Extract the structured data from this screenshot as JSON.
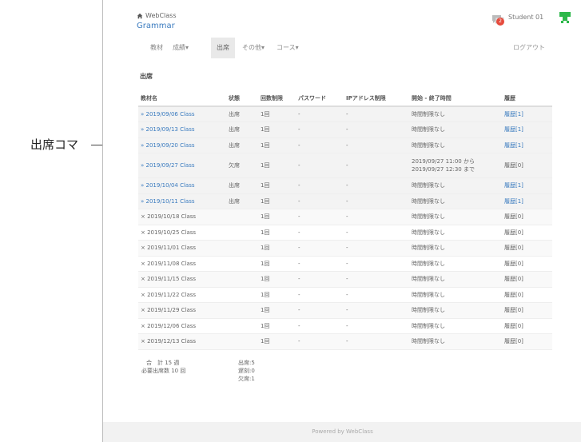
{
  "annotation": {
    "label": "出席コマ"
  },
  "header": {
    "home_label": "WebClass",
    "course_title": "Grammar",
    "notification_count": "2",
    "user_name": "Student 01"
  },
  "nav": {
    "items": [
      {
        "label": "教材"
      },
      {
        "label": "成績▾"
      },
      {
        "label": "出席"
      },
      {
        "label": "その他▾"
      },
      {
        "label": "コース▾"
      }
    ],
    "active_index": 2,
    "logout_label": "ログアウト"
  },
  "section_title": "出席",
  "table": {
    "headers": [
      "教材名",
      "状態",
      "回数制限",
      "パスワード",
      "IPアドレス制限",
      "開始 - 終了時間",
      "履歴"
    ],
    "rows": [
      {
        "name": "» 2019/09/06 Class",
        "status": "出席",
        "limit": "1回",
        "password": "-",
        "ip": "-",
        "period": "時間制限なし",
        "period2": "",
        "history": "履歴[1]"
      },
      {
        "name": "» 2019/09/13 Class",
        "status": "出席",
        "limit": "1回",
        "password": "-",
        "ip": "-",
        "period": "時間制限なし",
        "period2": "",
        "history": "履歴[1]"
      },
      {
        "name": "» 2019/09/20 Class",
        "status": "出席",
        "limit": "1回",
        "password": "-",
        "ip": "-",
        "period": "時間制限なし",
        "period2": "",
        "history": "履歴[1]"
      },
      {
        "name": "» 2019/09/27 Class",
        "status": "欠席",
        "limit": "1回",
        "password": "-",
        "ip": "-",
        "period": "2019/09/27 11:00 から",
        "period2": "2019/09/27 12:30 まで",
        "history": "履歴[0]"
      },
      {
        "name": "» 2019/10/04 Class",
        "status": "出席",
        "limit": "1回",
        "password": "-",
        "ip": "-",
        "period": "時間制限なし",
        "period2": "",
        "history": "履歴[1]"
      },
      {
        "name": "» 2019/10/11 Class",
        "status": "出席",
        "limit": "1回",
        "password": "-",
        "ip": "-",
        "period": "時間制限なし",
        "period2": "",
        "history": "履歴[1]"
      },
      {
        "name": "× 2019/10/18 Class",
        "status": "",
        "limit": "1回",
        "password": "-",
        "ip": "-",
        "period": "時間制限なし",
        "period2": "",
        "history": "履歴[0]"
      },
      {
        "name": "× 2019/10/25 Class",
        "status": "",
        "limit": "1回",
        "password": "-",
        "ip": "-",
        "period": "時間制限なし",
        "period2": "",
        "history": "履歴[0]"
      },
      {
        "name": "× 2019/11/01 Class",
        "status": "",
        "limit": "1回",
        "password": "-",
        "ip": "-",
        "period": "時間制限なし",
        "period2": "",
        "history": "履歴[0]"
      },
      {
        "name": "× 2019/11/08 Class",
        "status": "",
        "limit": "1回",
        "password": "-",
        "ip": "-",
        "period": "時間制限なし",
        "period2": "",
        "history": "履歴[0]"
      },
      {
        "name": "× 2019/11/15 Class",
        "status": "",
        "limit": "1回",
        "password": "-",
        "ip": "-",
        "period": "時間制限なし",
        "period2": "",
        "history": "履歴[0]"
      },
      {
        "name": "× 2019/11/22 Class",
        "status": "",
        "limit": "1回",
        "password": "-",
        "ip": "-",
        "period": "時間制限なし",
        "period2": "",
        "history": "履歴[0]"
      },
      {
        "name": "× 2019/11/29 Class",
        "status": "",
        "limit": "1回",
        "password": "-",
        "ip": "-",
        "period": "時間制限なし",
        "period2": "",
        "history": "履歴[0]"
      },
      {
        "name": "× 2019/12/06 Class",
        "status": "",
        "limit": "1回",
        "password": "-",
        "ip": "-",
        "period": "時間制限なし",
        "period2": "",
        "history": "履歴[0]"
      },
      {
        "name": "× 2019/12/13 Class",
        "status": "",
        "limit": "1回",
        "password": "-",
        "ip": "-",
        "period": "時間制限なし",
        "period2": "",
        "history": "履歴[0]"
      }
    ]
  },
  "summary": {
    "total": "合　計 15 週",
    "required": "必要出席数 10 回",
    "present": "出席:5",
    "late": "遅刻:0",
    "absent": "欠席:1"
  },
  "footer": {
    "text": "Powered by WebClass"
  },
  "colors": {
    "link": "#3a7bbf",
    "badge": "#e64a3c",
    "user_icon": "#2db84a"
  }
}
